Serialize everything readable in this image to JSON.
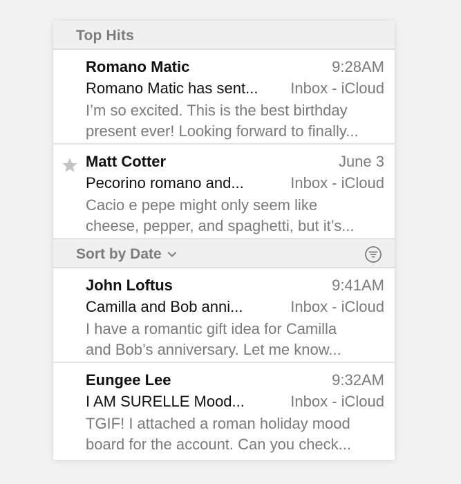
{
  "top_hits": {
    "title": "Top Hits",
    "messages": [
      {
        "sender": "Romano Matic",
        "time": "9:28AM",
        "subject": "Romano Matic has sent...",
        "mailbox": "Inbox - iCloud",
        "preview_line1": "I’m so excited. This is the best birthday",
        "preview_line2": "present ever! Looking forward to finally...",
        "starred": false
      },
      {
        "sender": "Matt Cotter",
        "time": "June 3",
        "subject": "Pecorino romano and...",
        "mailbox": "Inbox - iCloud",
        "preview_line1": "Cacio e pepe might only seem like",
        "preview_line2": "cheese, pepper, and spaghetti, but it’s...",
        "starred": true
      }
    ]
  },
  "sort_section": {
    "label": "Sort by Date",
    "messages": [
      {
        "sender": "John Loftus",
        "time": "9:41AM",
        "subject": "Camilla and Bob anni...",
        "mailbox": "Inbox - iCloud",
        "preview_line1": "I have a romantic gift idea for Camilla",
        "preview_line2": "and Bob’s anniversary. Let me know...",
        "starred": false
      },
      {
        "sender": "Eungee Lee",
        "time": "9:32AM",
        "subject": "I AM SURELLE Mood...",
        "mailbox": "Inbox - iCloud",
        "preview_line1": "TGIF! I attached a roman holiday mood",
        "preview_line2": "board for the account. Can you check...",
        "starred": false
      }
    ]
  },
  "icons": {
    "star": "star-icon",
    "chevron": "chevron-down-icon",
    "filter": "filter-icon"
  },
  "colors": {
    "header_bg": "#f0f0f0",
    "header_text": "#7c7c7c",
    "primary_text": "#111111",
    "secondary_text": "#7a7a7a",
    "star": "#c4c4c4"
  }
}
